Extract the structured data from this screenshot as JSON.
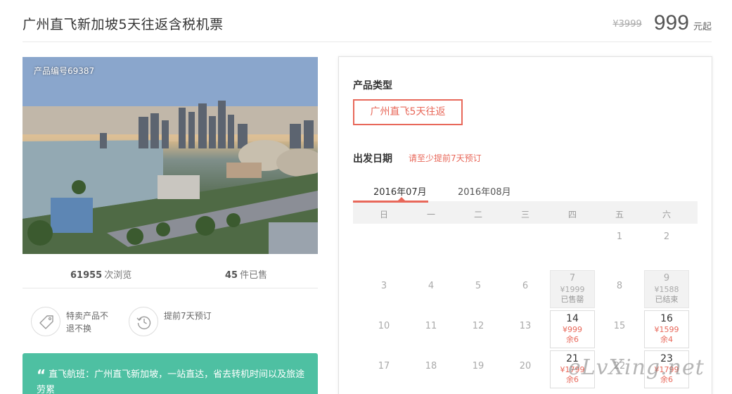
{
  "header": {
    "title": "广州直飞新加坡5天往返含税机票",
    "old_price": "¥3999",
    "price": "999",
    "price_suffix": "元起"
  },
  "product": {
    "number_label": "产品编号69387"
  },
  "stats": {
    "views_count": "61955",
    "views_label": "次浏览",
    "sold_count": "45",
    "sold_label": "件已售"
  },
  "features": [
    {
      "text": "特卖产品不退不换",
      "icon": "tag-icon"
    },
    {
      "text": "提前7天预订",
      "icon": "clock-history-icon"
    }
  ],
  "quote": {
    "text": "直飞航班：广州直飞新加坡，一站直达，省去转机时间以及旅途劳累"
  },
  "booking": {
    "product_type_label": "产品类型",
    "product_type_option": "广州直飞5天往返",
    "departure_label": "出发日期",
    "departure_hint": "请至少提前7天预订",
    "months": [
      "2016年07月",
      "2016年08月"
    ],
    "weekdays": [
      "日",
      "一",
      "二",
      "三",
      "四",
      "五",
      "六"
    ],
    "days": [
      {
        "day": "1"
      },
      {
        "day": "2"
      },
      {
        "day": "3"
      },
      {
        "day": "4"
      },
      {
        "day": "5"
      },
      {
        "day": "6"
      },
      {
        "day": "7",
        "price": "¥1999",
        "remark": "已售罄"
      },
      {
        "day": "8"
      },
      {
        "day": "9",
        "price": "¥1588",
        "remark": "已结束"
      },
      {
        "day": "10"
      },
      {
        "day": "11"
      },
      {
        "day": "12"
      },
      {
        "day": "13"
      },
      {
        "day": "14",
        "price": "¥999",
        "remark": "余6"
      },
      {
        "day": "15"
      },
      {
        "day": "16",
        "price": "¥1599",
        "remark": "余4"
      },
      {
        "day": "17"
      },
      {
        "day": "18"
      },
      {
        "day": "19"
      },
      {
        "day": "20"
      },
      {
        "day": "21",
        "price": "¥1799",
        "remark": "余6"
      },
      {
        "day": "22"
      },
      {
        "day": "23",
        "price": "¥1799",
        "remark": "余6"
      }
    ]
  },
  "watermark": "eLvXing.net",
  "colors": {
    "accent": "#e8685a",
    "quote_bg": "#4ec0a2"
  }
}
